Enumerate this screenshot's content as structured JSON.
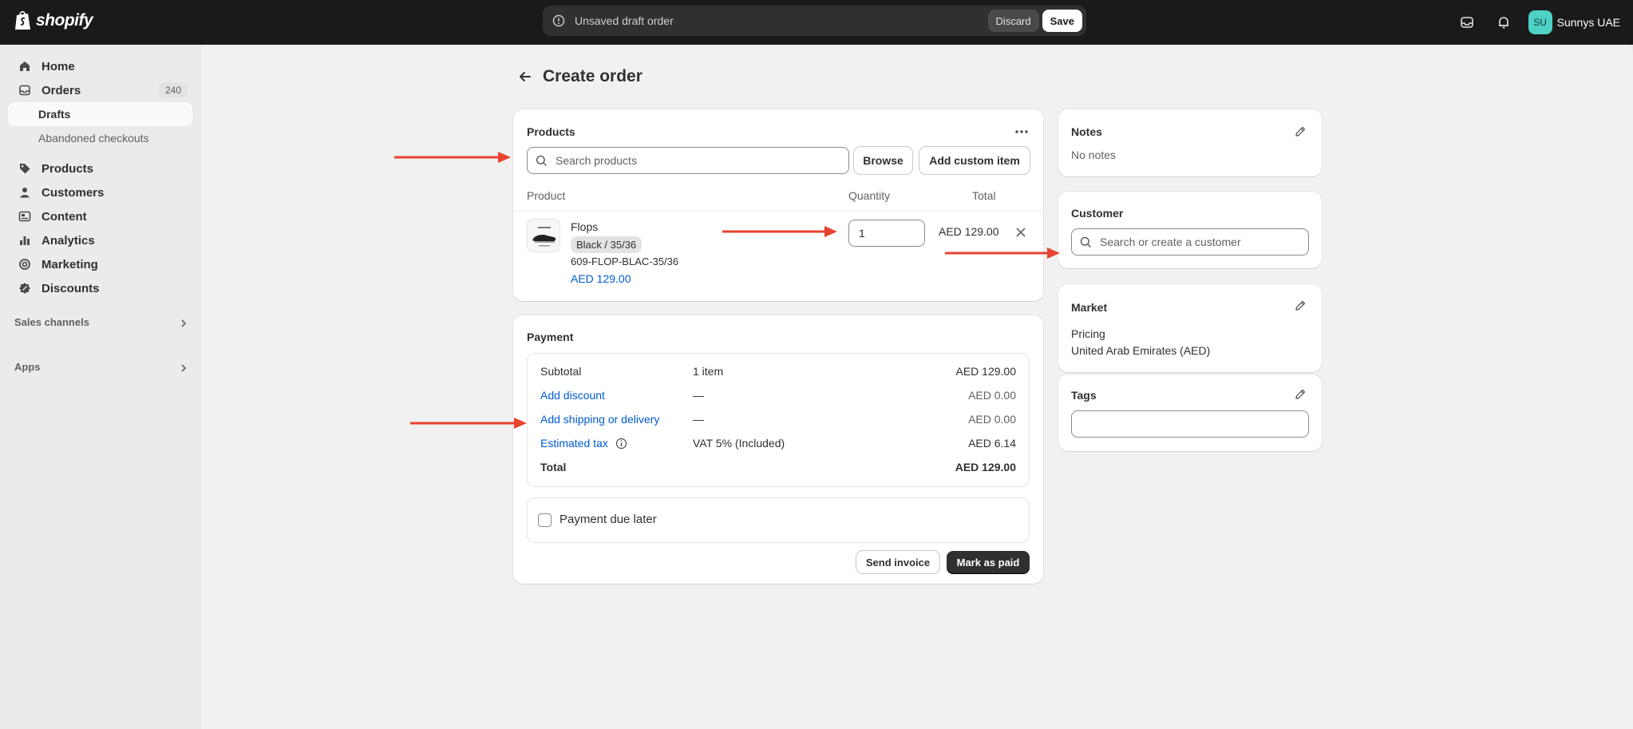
{
  "topbar": {
    "logo_text": "shopify",
    "draft_message": "Unsaved draft order",
    "discard_label": "Discard",
    "save_label": "Save",
    "avatar_initials": "SU",
    "store_name": "Sunnys UAE"
  },
  "sidebar": {
    "items": [
      {
        "label": "Home",
        "icon": "home-icon"
      },
      {
        "label": "Orders",
        "icon": "inbox-icon",
        "badge": "240"
      },
      {
        "label": "Drafts"
      },
      {
        "label": "Abandoned checkouts"
      },
      {
        "label": "Products",
        "icon": "tag-icon"
      },
      {
        "label": "Customers",
        "icon": "person-icon"
      },
      {
        "label": "Content",
        "icon": "content-icon"
      },
      {
        "label": "Analytics",
        "icon": "bar-chart-icon"
      },
      {
        "label": "Marketing",
        "icon": "target-icon"
      },
      {
        "label": "Discounts",
        "icon": "discount-icon"
      }
    ],
    "sales_channels_label": "Sales channels",
    "apps_label": "Apps"
  },
  "page": {
    "title": "Create order"
  },
  "products_card": {
    "title": "Products",
    "search_placeholder": "Search products",
    "browse_label": "Browse",
    "add_custom_label": "Add custom item",
    "columns": [
      "Product",
      "Quantity",
      "Total"
    ],
    "line_item": {
      "name": "Flops",
      "variant": "Black / 35/36",
      "sku": "609-FLOP-BLAC-35/36",
      "price": "AED 129.00",
      "quantity": "1",
      "total": "AED 129.00"
    }
  },
  "payment_card": {
    "title": "Payment",
    "rows": [
      {
        "label": "Subtotal",
        "mid": "1 item",
        "amount": "AED 129.00"
      },
      {
        "label": "Add discount",
        "mid": "—",
        "amount": "AED 0.00"
      },
      {
        "label": "Add shipping or delivery",
        "mid": "—",
        "amount": "AED 0.00"
      },
      {
        "label": "Estimated tax",
        "mid": "VAT 5% (Included)",
        "amount": "AED 6.14"
      },
      {
        "label": "Total",
        "mid": "",
        "amount": "AED 129.00"
      }
    ],
    "payment_due_label": "Payment due later",
    "send_invoice_label": "Send invoice",
    "mark_paid_label": "Mark as paid"
  },
  "notes_card": {
    "title": "Notes",
    "value": "No notes"
  },
  "customer_card": {
    "title": "Customer",
    "search_placeholder": "Search or create a customer"
  },
  "market_card": {
    "title": "Market",
    "pricing_label": "Pricing",
    "pricing_value": "United Arab Emirates (AED)"
  },
  "tags_card": {
    "title": "Tags",
    "value": ""
  },
  "colors": {
    "annotation_arrow": "#e8432e",
    "link": "#005bd3",
    "topbar": "#1a1a1a",
    "avatar": "#4fd1c5"
  }
}
